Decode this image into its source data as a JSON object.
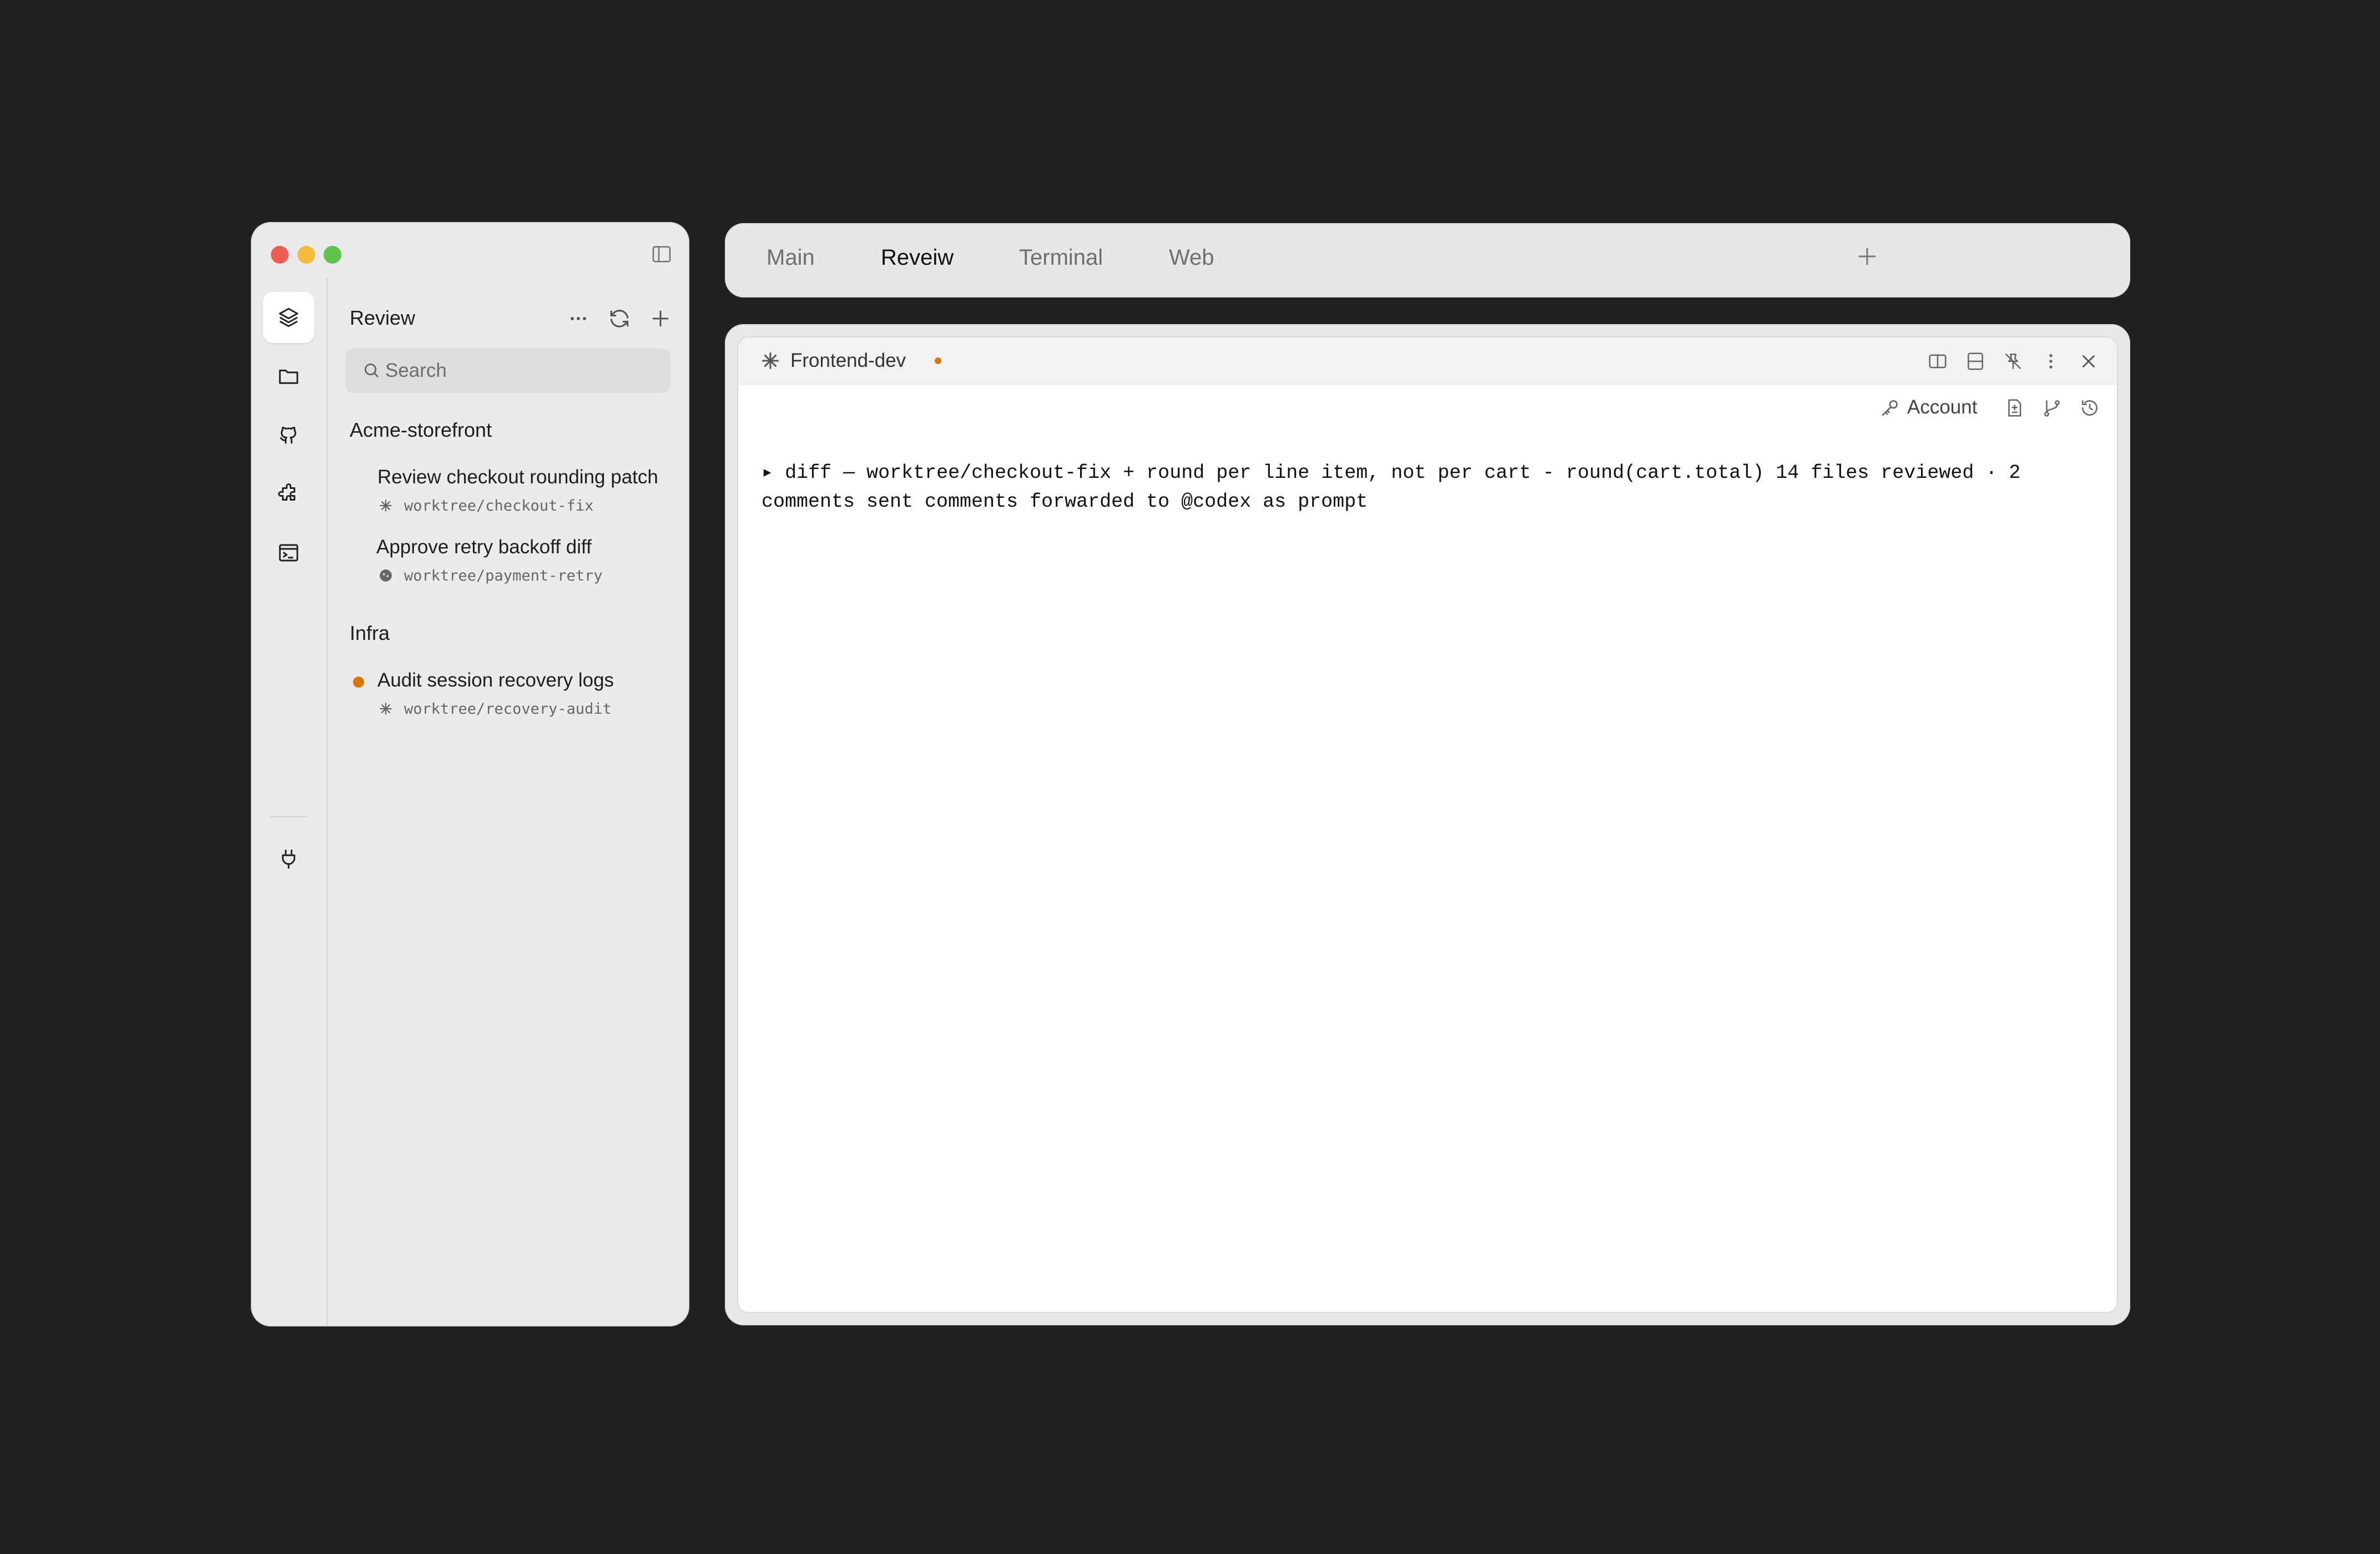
{
  "sidebar": {
    "rail": [
      {
        "name": "layers-icon",
        "active": true
      },
      {
        "name": "folder-icon",
        "active": false
      },
      {
        "name": "github-icon",
        "active": false
      },
      {
        "name": "puzzle-icon",
        "active": false
      },
      {
        "name": "terminal-window-icon",
        "active": false
      },
      {
        "name": "plug-icon",
        "active": false
      }
    ],
    "title": "Review",
    "search_placeholder": "Search",
    "groups": [
      {
        "label": "Acme-storefront",
        "tasks": [
          {
            "title": "Review checkout rounding patch",
            "branch": "worktree/checkout-fix",
            "icon": "spark-icon",
            "unread": false
          },
          {
            "title": "Approve retry backoff diff",
            "branch": "worktree/payment-retry",
            "icon": "agent-icon",
            "unread": false
          }
        ]
      },
      {
        "label": "Infra",
        "tasks": [
          {
            "title": "Audit session recovery logs",
            "branch": "worktree/recovery-audit",
            "icon": "spark-icon",
            "unread": true
          }
        ]
      }
    ]
  },
  "tabs": [
    {
      "label": "Main",
      "active": false
    },
    {
      "label": "Reveiw",
      "active": true
    },
    {
      "label": "Terminal",
      "active": false
    },
    {
      "label": "Web",
      "active": false
    }
  ],
  "pane": {
    "title": "Frontend-dev",
    "unsaved": true,
    "toolbar": {
      "account_label": "Account"
    },
    "output": "▸ diff — worktree/checkout-fix + round per line item, not per cart - round(cart.total) 14 files reviewed · 2 comments sent comments forwarded to @codex as prompt"
  },
  "colors": {
    "background": "#202022",
    "accent_dot": "#d97706",
    "close": "#ee5c53",
    "minimize": "#f3bd3b",
    "zoom": "#5ec34a"
  }
}
